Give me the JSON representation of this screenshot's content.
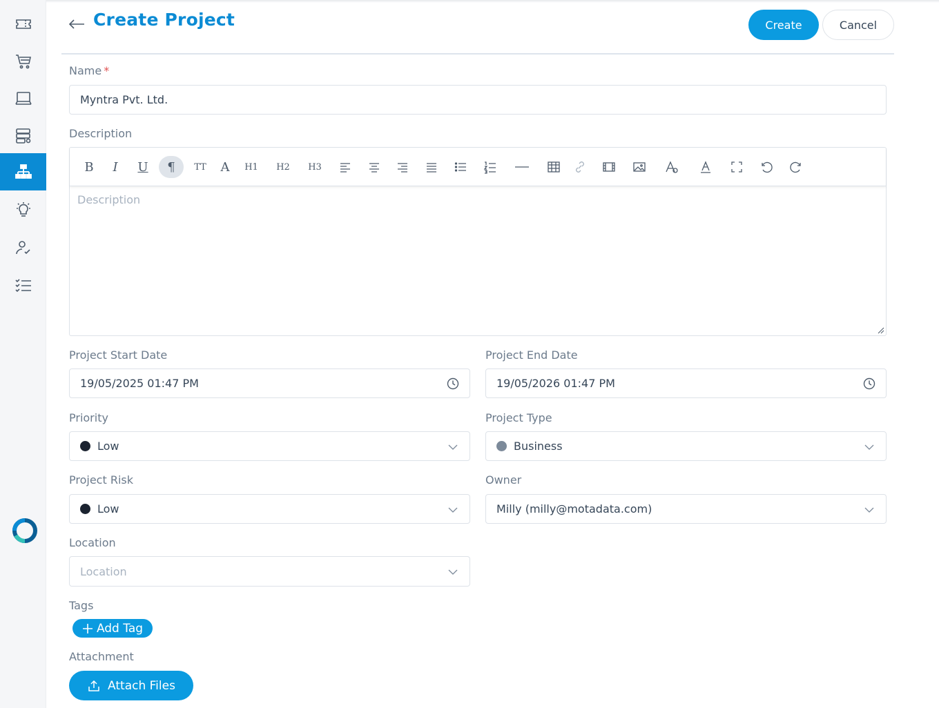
{
  "page": {
    "title": "Create Project"
  },
  "actions": {
    "create_label": "Create",
    "cancel_label": "Cancel"
  },
  "sidebar": {
    "items": [
      {
        "icon": "ticket-icon"
      },
      {
        "icon": "cart-icon"
      },
      {
        "icon": "laptop-icon"
      },
      {
        "icon": "server-icon"
      },
      {
        "icon": "project-hierarchy-icon",
        "active": true
      },
      {
        "icon": "lightbulb-icon"
      },
      {
        "icon": "user-check-icon"
      },
      {
        "icon": "task-list-icon"
      }
    ],
    "accent": "#0b8bd4"
  },
  "form": {
    "name": {
      "label": "Name",
      "required_mark": "*",
      "value": "Myntra Pvt. Ltd."
    },
    "description": {
      "label": "Description",
      "placeholder": "Description"
    },
    "start_date": {
      "label": "Project Start Date",
      "value": "19/05/2025 01:47 PM"
    },
    "end_date": {
      "label": "Project End Date",
      "value": "19/05/2026 01:47 PM"
    },
    "priority": {
      "label": "Priority",
      "value": "Low",
      "dot_color": "#1b2330"
    },
    "project_type": {
      "label": "Project Type",
      "value": "Business",
      "dot_color": "#7c8a9a"
    },
    "project_risk": {
      "label": "Project Risk",
      "value": "Low",
      "dot_color": "#1b2330"
    },
    "owner": {
      "label": "Owner",
      "value": "Milly (milly@motadata.com)"
    },
    "location": {
      "label": "Location",
      "placeholder": "Location"
    },
    "tags": {
      "label": "Tags",
      "add_label": "Add Tag"
    },
    "attachment": {
      "label": "Attachment",
      "button_label": "Attach Files"
    }
  },
  "toolbar": {
    "bold": "B",
    "italic": "I",
    "underline": "U",
    "paragraph": "¶",
    "text_size": "TT",
    "font": "A",
    "h1": "H1",
    "h2": "H2",
    "h3": "H3"
  }
}
